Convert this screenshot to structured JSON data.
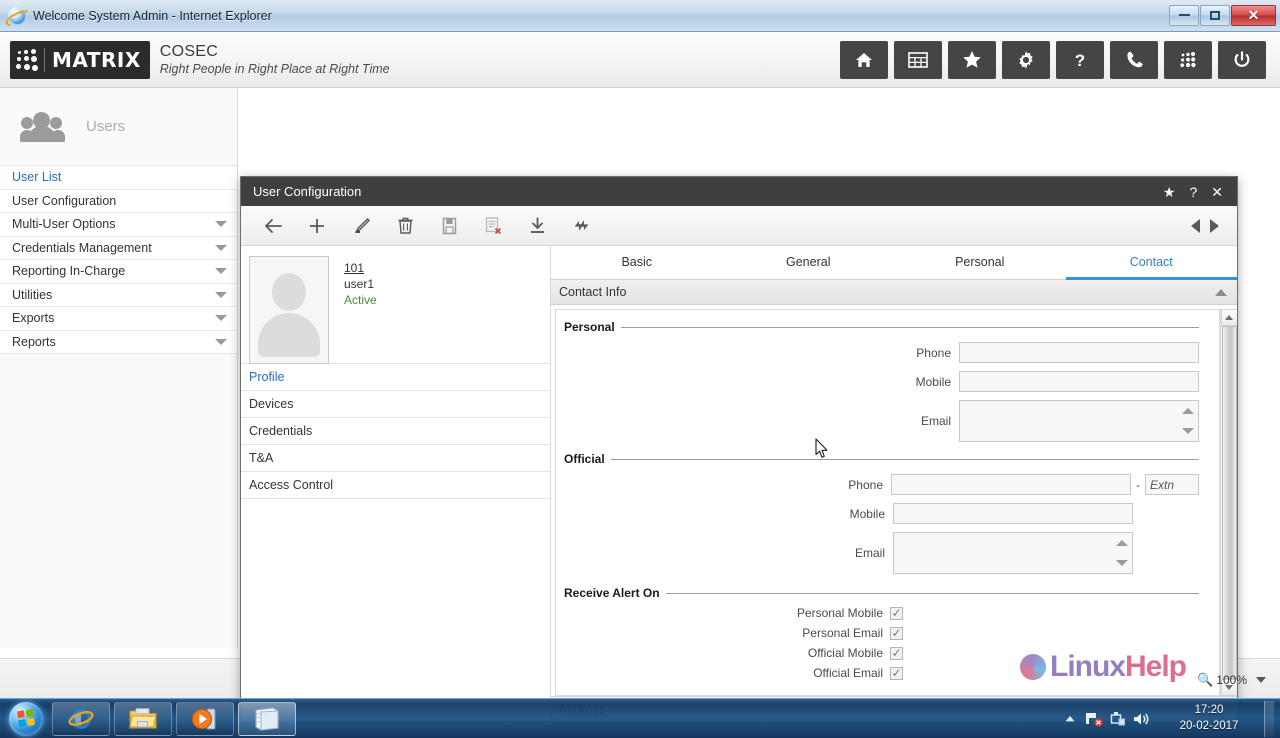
{
  "window": {
    "title": "Welcome System Admin - Internet Explorer",
    "minimize_label": "Minimize",
    "maximize_label": "Maximize",
    "close_label": "Close"
  },
  "app_header": {
    "logo_word": "MATRIX",
    "product": "COSEC",
    "tagline": "Right People in Right Place at Right Time",
    "tools": [
      {
        "name": "home-icon",
        "label": "Home"
      },
      {
        "name": "grid-icon",
        "label": "Dashboard"
      },
      {
        "name": "star-icon",
        "label": "Favorites"
      },
      {
        "name": "gear-icon",
        "label": "Settings"
      },
      {
        "name": "help-icon",
        "label": "?"
      },
      {
        "name": "phone-icon",
        "label": "Support"
      },
      {
        "name": "dots-icon",
        "label": "Apps"
      },
      {
        "name": "power-icon",
        "label": "Logout"
      }
    ]
  },
  "sidebar": {
    "header_label": "Users",
    "items": [
      {
        "label": "User List",
        "active": true,
        "caret": false
      },
      {
        "label": "User Configuration",
        "active": false,
        "caret": false
      },
      {
        "label": "Multi-User Options",
        "active": false,
        "caret": true
      },
      {
        "label": "Credentials Management",
        "active": false,
        "caret": true
      },
      {
        "label": "Reporting In-Charge",
        "active": false,
        "caret": true
      },
      {
        "label": "Utilities",
        "active": false,
        "caret": true
      },
      {
        "label": "Exports",
        "active": false,
        "caret": true
      },
      {
        "label": "Reports",
        "active": false,
        "caret": true
      }
    ]
  },
  "modal": {
    "title": "User Configuration",
    "title_actions": [
      {
        "name": "favorite-icon",
        "glyph": "★"
      },
      {
        "name": "help-icon",
        "glyph": "?"
      },
      {
        "name": "close-icon",
        "glyph": "✕"
      }
    ],
    "toolbar": [
      {
        "name": "back-button",
        "label": "Back"
      },
      {
        "name": "add-button",
        "label": "Add"
      },
      {
        "name": "edit-button",
        "label": "Edit"
      },
      {
        "name": "delete-button",
        "label": "Delete"
      },
      {
        "name": "save-button",
        "label": "Save"
      },
      {
        "name": "clear-button",
        "label": "Clear"
      },
      {
        "name": "download-button",
        "label": "Download"
      },
      {
        "name": "refresh-button",
        "label": "Refresh"
      }
    ],
    "nav_prev_label": "Previous",
    "nav_next_label": "Next"
  },
  "user": {
    "id": "101",
    "name": "user1",
    "status": "Active",
    "status_color": "#4a8a3e",
    "menu": [
      {
        "label": "Profile",
        "active": true
      },
      {
        "label": "Devices",
        "active": false
      },
      {
        "label": "Credentials",
        "active": false
      },
      {
        "label": "T&A",
        "active": false
      },
      {
        "label": "Access Control",
        "active": false
      }
    ]
  },
  "tabs": [
    {
      "label": "Basic",
      "active": false
    },
    {
      "label": "General",
      "active": false
    },
    {
      "label": "Personal",
      "active": false
    },
    {
      "label": "Contact",
      "active": true
    }
  ],
  "form": {
    "contact_info_header": "Contact Info",
    "address_header": "Address",
    "personal": {
      "title": "Personal",
      "phone_label": "Phone",
      "phone_value": "",
      "mobile_label": "Mobile",
      "mobile_value": "",
      "email_label": "Email",
      "email_value": ""
    },
    "official": {
      "title": "Official",
      "phone_label": "Phone",
      "phone_value": "",
      "extn_placeholder": "Extn",
      "extn_value": "",
      "separator": "-",
      "mobile_label": "Mobile",
      "mobile_value": "",
      "email_label": "Email",
      "email_value": ""
    },
    "alerts": {
      "title": "Receive Alert On",
      "items": [
        {
          "label": "Personal Mobile",
          "checked": true
        },
        {
          "label": "Personal Email",
          "checked": true
        },
        {
          "label": "Official Mobile",
          "checked": true
        },
        {
          "label": "Official Email",
          "checked": true
        }
      ],
      "check_glyph": "✓"
    }
  },
  "watermark": {
    "text_a": "Linux",
    "text_b": "Help"
  },
  "zoom_control": {
    "level": "100%"
  },
  "taskbar": {
    "start_label": "Start",
    "apps": [
      {
        "name": "internet-explorer-taskbar-icon",
        "label": "Internet Explorer",
        "active": false
      },
      {
        "name": "file-explorer-taskbar-icon",
        "label": "Windows Explorer",
        "active": false
      },
      {
        "name": "media-player-taskbar-icon",
        "label": "Windows Media Player",
        "active": false
      },
      {
        "name": "app-window-taskbar-icon",
        "label": "Notepad",
        "active": true
      }
    ],
    "tray": [
      {
        "name": "show-hidden-icons-icon",
        "label": "Show hidden icons"
      },
      {
        "name": "network-icon",
        "label": "Network"
      },
      {
        "name": "action-center-icon",
        "label": "Action Center"
      },
      {
        "name": "volume-icon",
        "label": "Volume"
      }
    ],
    "time": "17:20",
    "date": "20-02-2017"
  },
  "colors": {
    "accent": "#2f80c8",
    "header_dark": "#454545",
    "modal_title": "#3f3f3f",
    "status_green": "#4a8a3e"
  }
}
